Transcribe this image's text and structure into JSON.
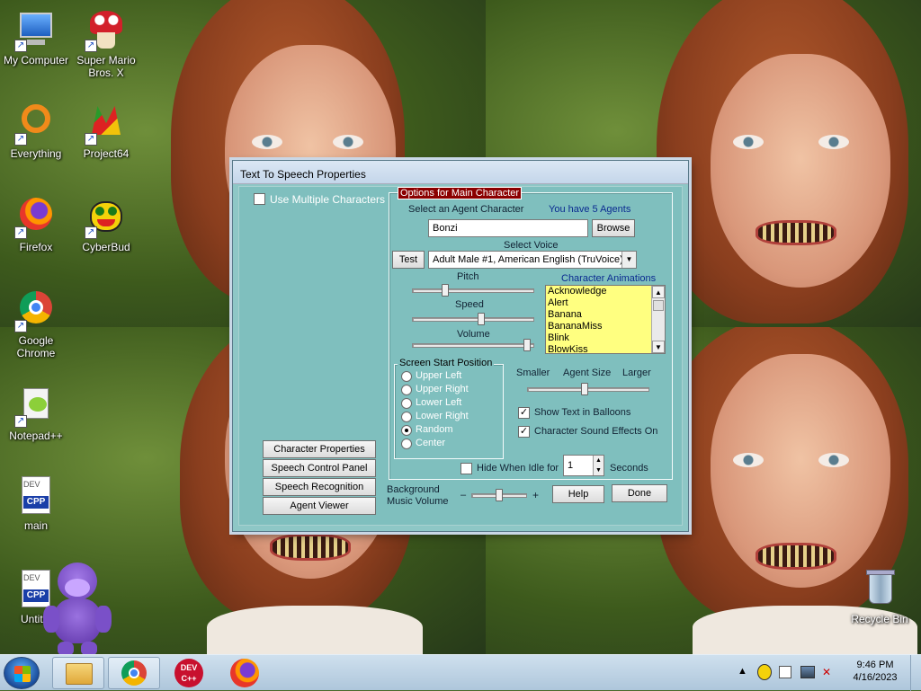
{
  "desktop": {
    "icons": [
      {
        "label": "My Computer",
        "icon": "computer-icon"
      },
      {
        "label": "Super Mario Bros. X",
        "icon": "mushroom-icon"
      },
      {
        "label": "Everything",
        "icon": "search-ring-icon"
      },
      {
        "label": "Project64",
        "icon": "n64-icon"
      },
      {
        "label": "Firefox",
        "icon": "firefox-icon"
      },
      {
        "label": "CyberBud",
        "icon": "cyberbud-icon"
      },
      {
        "label": "Google Chrome",
        "icon": "chrome-icon"
      },
      {
        "label": "Notepad++",
        "icon": "notepadpp-icon"
      },
      {
        "label": "main",
        "icon": "cpp-file-icon"
      },
      {
        "label": "Untitle",
        "icon": "cpp-file-icon"
      },
      {
        "label": "Recycle Bin",
        "icon": "recycle-bin-icon"
      }
    ],
    "cpp_badge": "CPP",
    "dev_badge": "DEV"
  },
  "dialog": {
    "title": "Text To Speech Properties",
    "use_multiple": "Use Multiple Characters",
    "use_multiple_checked": false,
    "options_group_title": "Options for Main Character",
    "select_agent_label": "Select an Agent Character",
    "agents_count_label": "You have 5 Agents",
    "agent_value": "Bonzi",
    "browse_label": "Browse",
    "select_voice_label": "Select Voice",
    "test_label": "Test",
    "voice_value": "Adult Male #1, American English (TruVoice)",
    "pitch_label": "Pitch",
    "speed_label": "Speed",
    "volume_label": "Volume",
    "pitch_level": 0.25,
    "speed_level": 0.57,
    "volume_level": 0.98,
    "animations_label": "Character Animations",
    "animations": [
      "Acknowledge",
      "Alert",
      "Banana",
      "BananaMiss",
      "Blink",
      "BlowKiss"
    ],
    "screen_pos_title": "Screen Start Position",
    "positions": [
      "Upper Left",
      "Upper Right",
      "Lower Left",
      "Lower Right",
      "Random",
      "Center"
    ],
    "selected_position": "Random",
    "smaller_label": "Smaller",
    "agent_size_label": "Agent Size",
    "larger_label": "Larger",
    "agent_size_level": 0.47,
    "show_balloons": "Show Text in Balloons",
    "show_balloons_checked": true,
    "sound_effects": "Character Sound Effects On",
    "sound_effects_checked": true,
    "hide_idle": "Hide When Idle for",
    "hide_idle_checked": false,
    "idle_value": "1",
    "seconds_label": "Seconds",
    "bg_music_label_1": "Background",
    "bg_music_label_2": "Music Volume",
    "minus": "–",
    "plus": "+",
    "bg_music_level": 0.5,
    "help_label": "Help",
    "done_label": "Done",
    "buttons": [
      "Character Properties",
      "Speech Control Panel",
      "Speech Recognition",
      "Agent Viewer"
    ]
  },
  "taskbar": {
    "pinned": [
      "windows-explorer-icon",
      "chrome-icon",
      "devcpp-icon",
      "firefox-icon"
    ],
    "time": "9:46 PM",
    "date": "4/16/2023",
    "dev_cpp_text_1": "DEV",
    "dev_cpp_text_2": "C++"
  },
  "colors": {
    "dialog_bg": "#7fbfbe",
    "listbox_bg": "#ffff80",
    "title_highlight": "#8b0000"
  }
}
